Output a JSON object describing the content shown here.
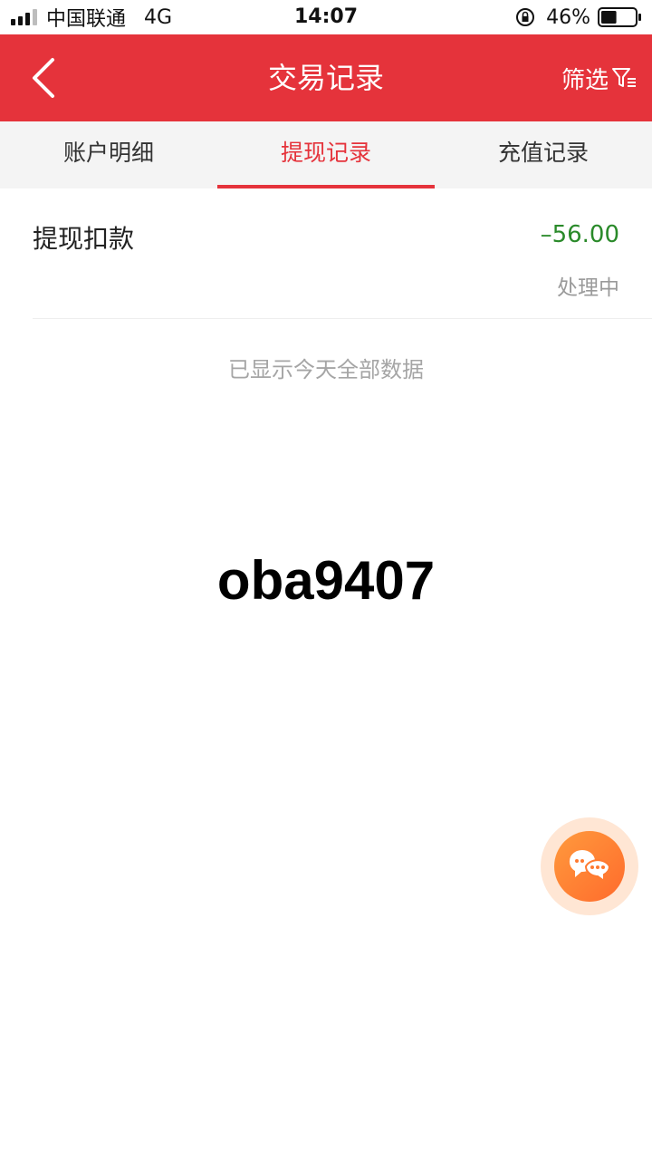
{
  "status_bar": {
    "carrier": "中国联通",
    "network": "4G",
    "time": "14:07",
    "battery": "46%",
    "battery_level": 0.46
  },
  "header": {
    "title": "交易记录",
    "filter_label": "筛选",
    "background_color": "#e5333b"
  },
  "tabs": [
    {
      "label": "账户明细",
      "active": false
    },
    {
      "label": "提现记录",
      "active": true
    },
    {
      "label": "充值记录",
      "active": false
    }
  ],
  "records": [
    {
      "title": "提现扣款",
      "amount": "–56.00",
      "status": "处理中"
    }
  ],
  "list_end_text": "已显示今天全部数据",
  "watermark": "oba9407",
  "icons": {
    "back": "chevron-left-icon",
    "filter": "filter-icon",
    "chat": "chat-bubbles-icon"
  },
  "colors": {
    "accent": "#e5333b",
    "amount": "#2a8a2a",
    "chat": "#ff7a30"
  }
}
